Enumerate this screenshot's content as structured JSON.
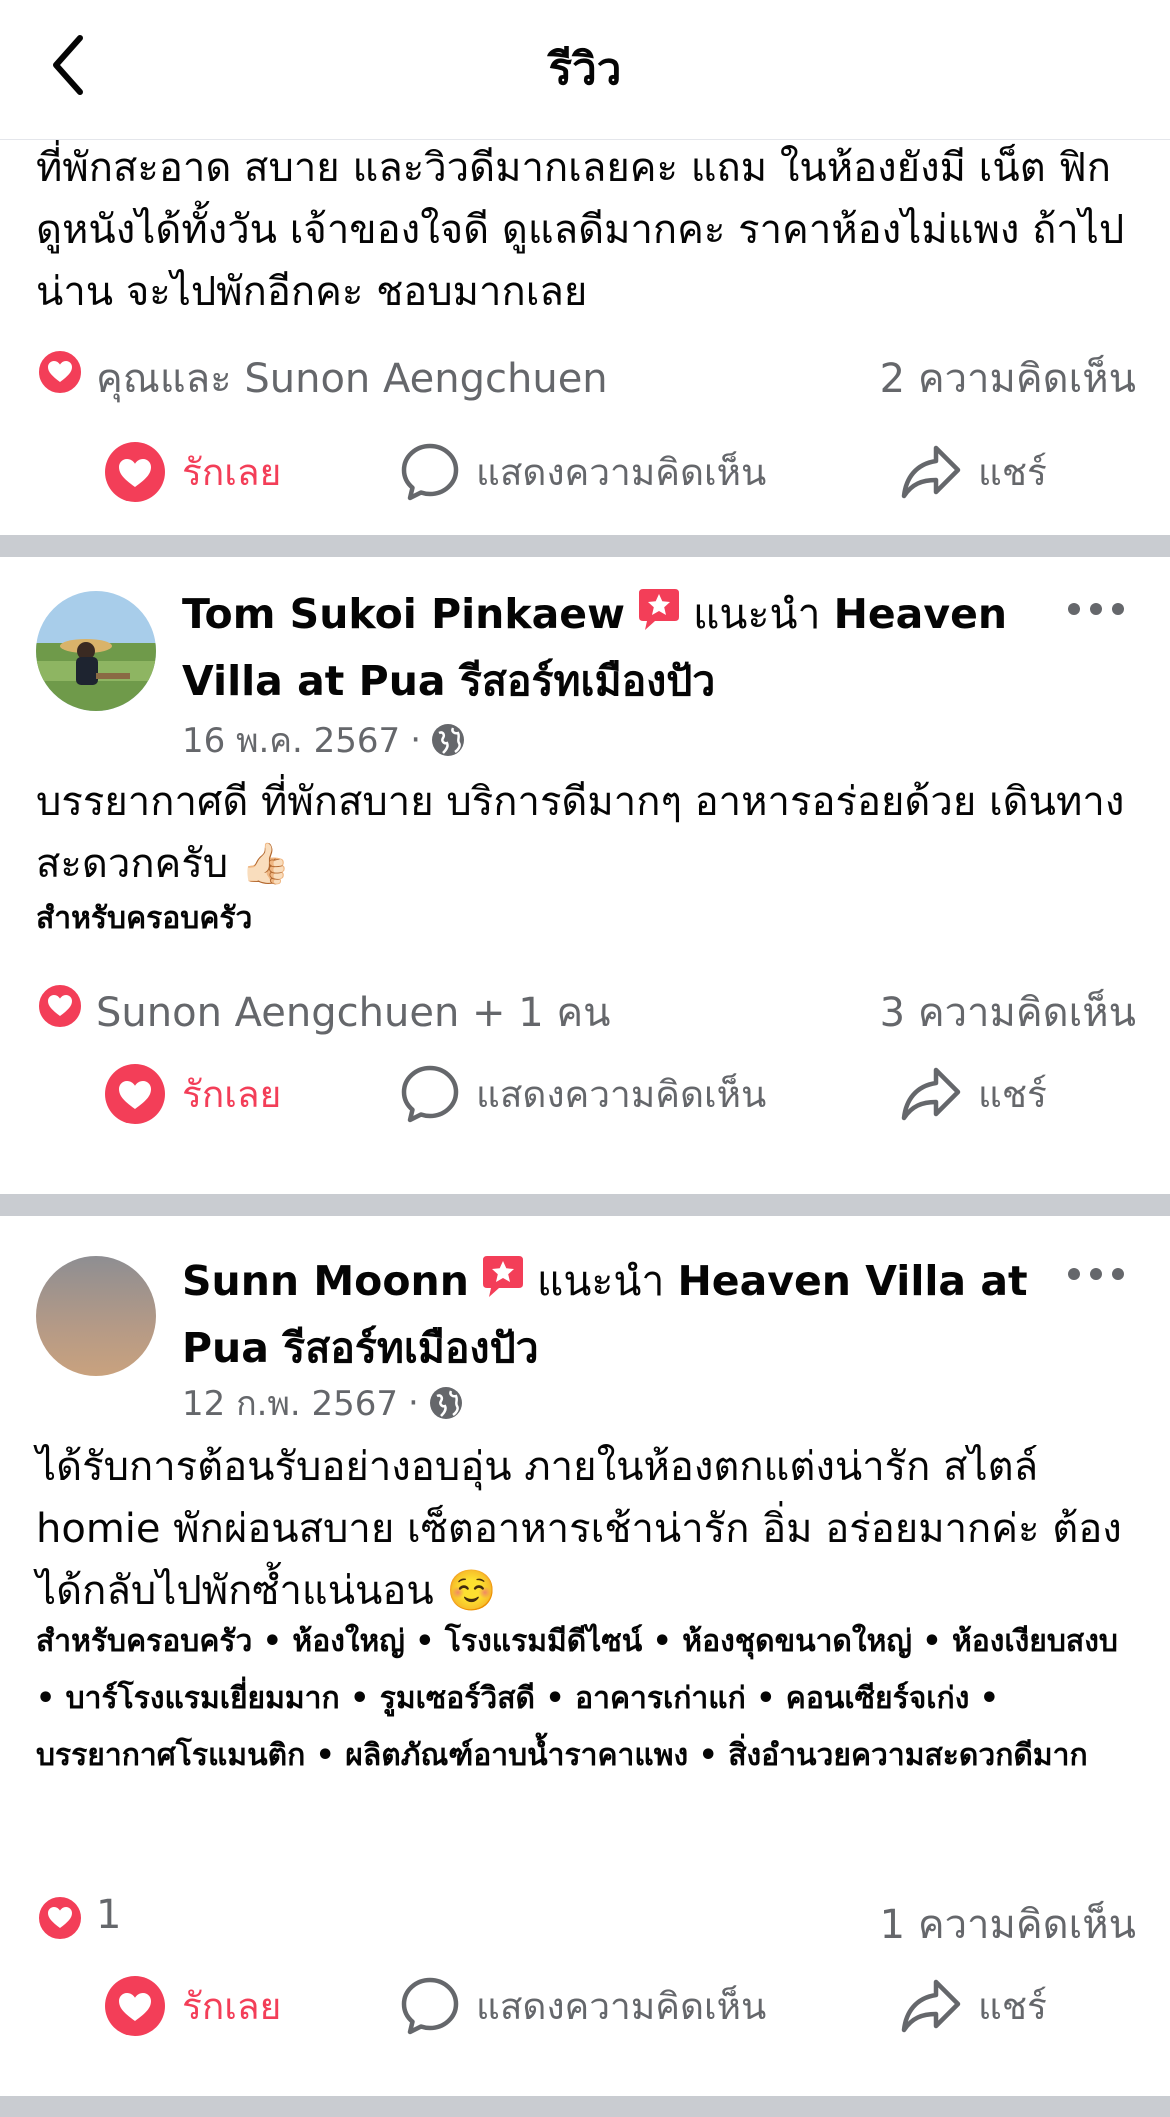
{
  "header": {
    "title": "รีวิว"
  },
  "posts": [
    {
      "text": "ที่พักสะอาด สบาย และวิวดีมากเลยคะ แถม ในห้องยังมี เน็ต ฟิก ดูหนังได้ทั้งวัน เจ้าของใจดี ดูแลดีมากคะ ราคาห้องไม่แพง ถ้าไป น่าน จะไปพักอีกคะ ชอบมากเลย",
      "reactions": "คุณและ Sunon Aengchuen",
      "comments": "2 ความคิดเห็น"
    },
    {
      "author": "Tom Sukoi Pinkaew",
      "recommend_word": "แนะนำ",
      "place": "Heaven Villa at Pua รีสอร์ทเมืองปัว",
      "date": "16 พ.ค. 2567",
      "text": "บรรยากาศดี ที่พักสบาย บริการดีมากๆ อาหารอร่อยด้วย เดินทางสะดวกครับ 👍🏻",
      "tags": "สำหรับครอบครัว",
      "reactions": "Sunon Aengchuen + 1 คน",
      "comments": "3 ความคิดเห็น"
    },
    {
      "author": "Sunn Moonn",
      "recommend_word": "แนะนำ",
      "place": "Heaven Villa at Pua รีสอร์ทเมืองปัว",
      "date": "12 ก.พ. 2567",
      "text": "ได้รับการต้อนรับอย่างอบอุ่น ภายในห้องตกแต่งน่ารัก สไตล์ homie พักผ่อนสบาย เซ็ตอาหารเช้าน่ารัก อิ่ม อร่อยมากค่ะ ต้องได้กลับไปพักซ้ำแน่นอน ☺️",
      "tags": "สำหรับครอบครัว • ห้องใหญ่ • โรงแรมมีดีไซน์ • ห้องชุดขนาดใหญ่ • ห้องเงียบสงบ • บาร์โรงแรมเยี่ยมมาก • รูมเซอร์วิสดี • อาคารเก่าแก่ • คอนเซียร์จเก่ง • บรรยากาศโรแมนติก • ผลิตภัณฑ์อาบน้ำราคาแพง • สิ่งอำนวยความสะดวกดีมาก",
      "reactions": "1",
      "comments": "1 ความคิดเห็น"
    }
  ],
  "actions": {
    "love": "รักเลย",
    "comment": "แสดงความคิดเห็น",
    "share": "แชร์"
  },
  "colors": {
    "love": "#f33e58",
    "secondary_text": "#65676b",
    "separator": "#c9ccd1"
  },
  "icons": [
    "back-arrow-icon",
    "heart-icon",
    "comment-bubble-icon",
    "share-arrow-icon",
    "recommend-badge-icon",
    "globe-icon",
    "more-dots-icon"
  ]
}
